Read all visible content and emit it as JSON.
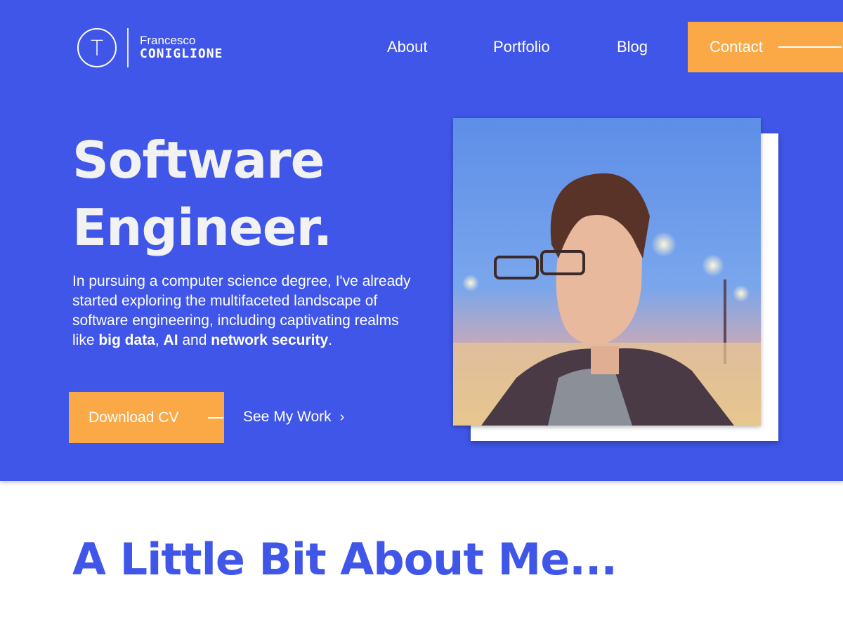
{
  "brand": {
    "monogram": "T",
    "first_name": "Francesco",
    "last_name": "CONIGLIONE"
  },
  "nav": {
    "about": "About",
    "portfolio": "Portfolio",
    "blog": "Blog",
    "contact": "Contact"
  },
  "hero": {
    "headline_line1": "Software",
    "headline_line2": "Engineer.",
    "intro_part1": "In pursuing a computer science degree, I've already started exploring the multifaceted landscape of software engineering, including captivating realms like ",
    "intro_bold1": "big data",
    "intro_sep1": ", ",
    "intro_bold2": "AI",
    "intro_sep2": " and ",
    "intro_bold3": "network security",
    "intro_end": ".",
    "download_cv": "Download CV",
    "see_work": "See My Work",
    "see_work_icon": "chevron-right-icon",
    "photo_alt": "Portrait photo of Francesco Coniglione"
  },
  "about": {
    "title": "A Little Bit About Me..."
  },
  "colors": {
    "primary": "#3f56e8",
    "accent": "#fba846",
    "text_light": "#ffffff"
  }
}
